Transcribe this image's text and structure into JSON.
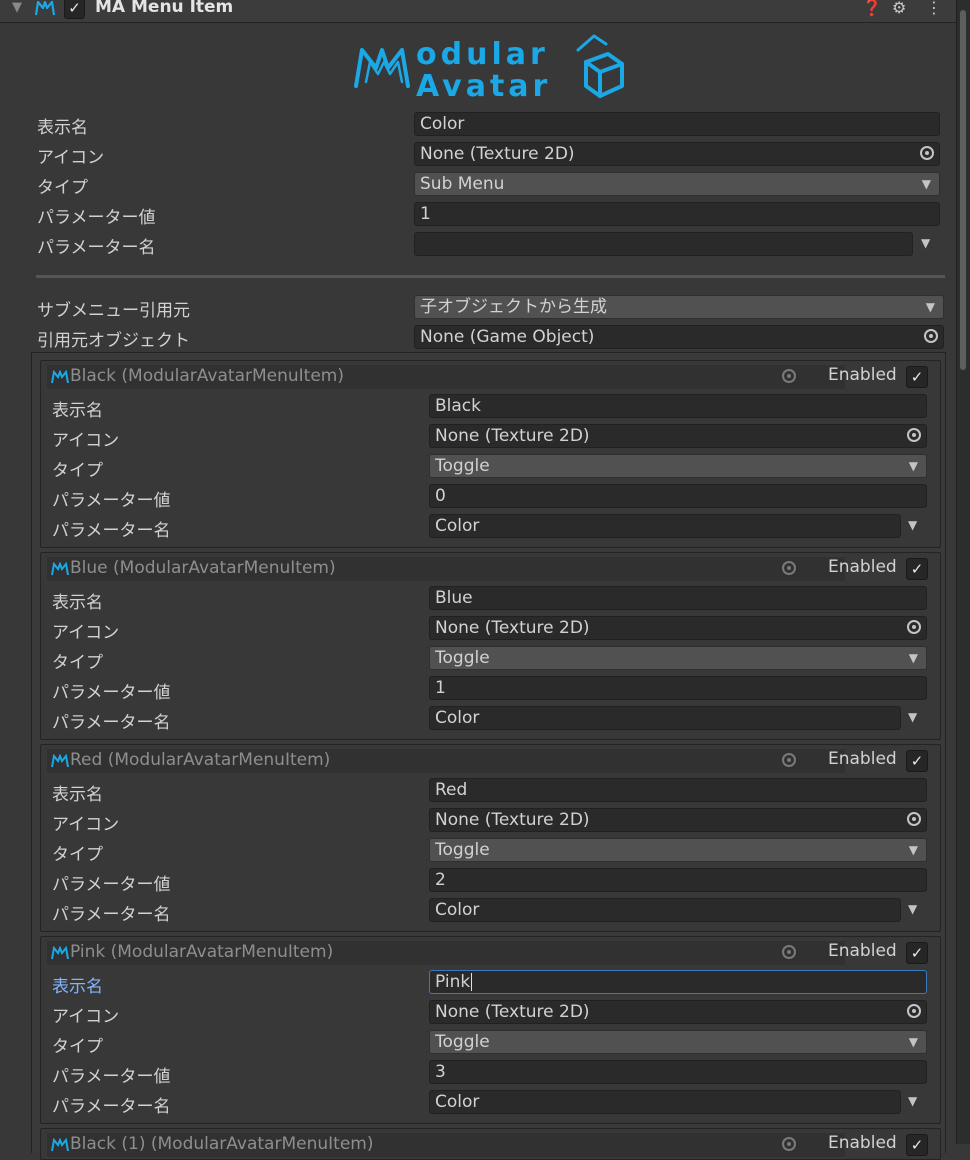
{
  "header": {
    "title": "MA Menu Item",
    "enabled": true,
    "icons": [
      "help-icon",
      "preset-icon",
      "more-icon"
    ]
  },
  "main": {
    "display_name_label": "表示名",
    "display_name": "Color",
    "icon_label": "アイコン",
    "icon_value": "None (Texture 2D)",
    "type_label": "タイプ",
    "type_value": "Sub Menu",
    "param_value_label": "パラメーター値",
    "param_value": "1",
    "param_name_label": "パラメーター名",
    "param_name": "",
    "submenu_source_label": "サブメニュー引用元",
    "submenu_source": "子オブジェクトから生成",
    "source_object_label": "引用元オブジェクト",
    "source_object": "None (Game Object)"
  },
  "children": [
    {
      "header": "Black (ModularAvatarMenuItem)",
      "enabled_label": "Enabled",
      "display_name_label": "表示名",
      "display_name": "Black",
      "icon_label": "アイコン",
      "icon_value": "None (Texture 2D)",
      "type_label": "タイプ",
      "type_value": "Toggle",
      "param_value_label": "パラメーター値",
      "param_value": "0",
      "param_name_label": "パラメーター名",
      "param_name": "Color"
    },
    {
      "header": "Blue (ModularAvatarMenuItem)",
      "enabled_label": "Enabled",
      "display_name_label": "表示名",
      "display_name": "Blue",
      "icon_label": "アイコン",
      "icon_value": "None (Texture 2D)",
      "type_label": "タイプ",
      "type_value": "Toggle",
      "param_value_label": "パラメーター値",
      "param_value": "1",
      "param_name_label": "パラメーター名",
      "param_name": "Color"
    },
    {
      "header": "Red (ModularAvatarMenuItem)",
      "enabled_label": "Enabled",
      "display_name_label": "表示名",
      "display_name": "Red",
      "icon_label": "アイコン",
      "icon_value": "None (Texture 2D)",
      "type_label": "タイプ",
      "type_value": "Toggle",
      "param_value_label": "パラメーター値",
      "param_value": "2",
      "param_name_label": "パラメーター名",
      "param_name": "Color"
    },
    {
      "header": "Pink (ModularAvatarMenuItem)",
      "enabled_label": "Enabled",
      "display_name_label": "表示名",
      "display_name": "Pink",
      "icon_label": "アイコン",
      "icon_value": "None (Texture 2D)",
      "type_label": "タイプ",
      "type_value": "Toggle",
      "param_value_label": "パラメーター値",
      "param_value": "3",
      "param_name_label": "パラメーター名",
      "param_name": "Color"
    },
    {
      "header": "Black (1) (ModularAvatarMenuItem)",
      "enabled_label": "Enabled"
    }
  ],
  "colors": {
    "background": "#383838",
    "field": "#2a2a2a",
    "dropdown": "#515151",
    "focus": "#81b4ff",
    "logo": "#1aa8e6"
  }
}
